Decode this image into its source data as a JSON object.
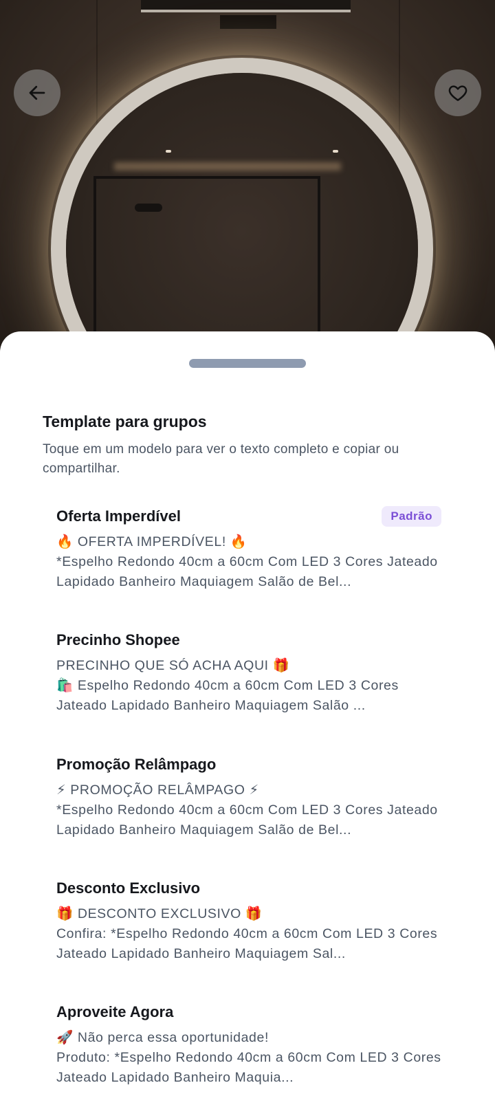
{
  "nav": {
    "back_icon": "arrow-left-icon",
    "favorite_icon": "heart-icon"
  },
  "sheet": {
    "title": "Template para grupos",
    "subtitle": "Toque em um modelo para ver o texto completo e copiar ou compartilhar."
  },
  "templates": [
    {
      "name": "Oferta Imperdível",
      "badge": "Padrão",
      "preview": "🔥 OFERTA IMPERDÍVEL! 🔥\n*Espelho Redondo 40cm a 60cm Com LED 3 Cores Jateado Lapidado Banheiro Maquiagem Salão de Bel..."
    },
    {
      "name": "Precinho Shopee",
      "badge": "",
      "preview": "PRECINHO QUE SÓ ACHA AQUI 🎁\n🛍️ Espelho Redondo 40cm a 60cm Com LED 3 Cores Jateado Lapidado Banheiro Maquiagem Salão ..."
    },
    {
      "name": "Promoção Relâmpago",
      "badge": "",
      "preview": "⚡ PROMOÇÃO RELÂMPAGO ⚡\n*Espelho Redondo 40cm a 60cm Com LED 3 Cores Jateado Lapidado Banheiro Maquiagem Salão de Bel..."
    },
    {
      "name": "Desconto Exclusivo",
      "badge": "",
      "preview": "🎁 DESCONTO EXCLUSIVO 🎁\nConfira: *Espelho Redondo 40cm a 60cm Com LED 3 Cores Jateado Lapidado Banheiro Maquiagem Sal..."
    },
    {
      "name": "Aproveite Agora",
      "badge": "",
      "preview": "🚀 Não perca essa oportunidade!\nProduto: *Espelho Redondo 40cm a 60cm Com LED 3 Cores Jateado Lapidado Banheiro Maquia..."
    }
  ]
}
